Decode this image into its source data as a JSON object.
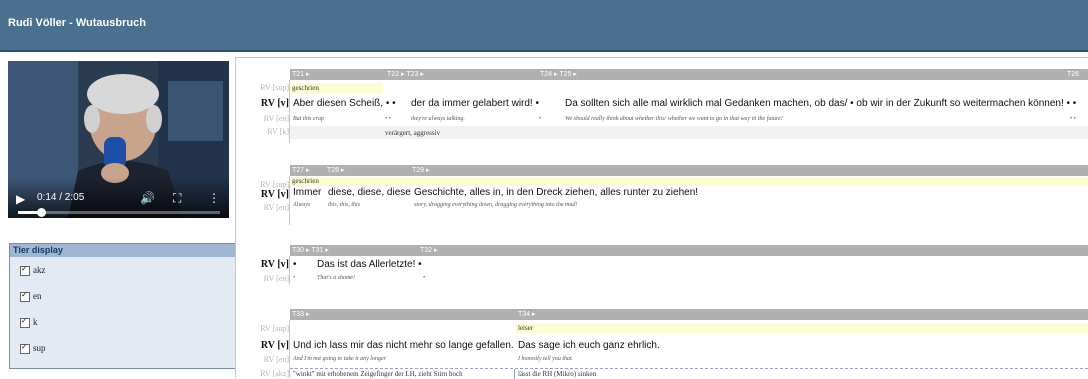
{
  "header": {
    "title": "Rudi Völler - Wutausbruch"
  },
  "colors": {
    "header_bg": "#4a6f8f",
    "sup_bg": "#fdfdd2",
    "timeline_bg": "#b0b0b0"
  },
  "video": {
    "time": "0:14 / 2:05",
    "progress": 0.112,
    "icons": [
      "play-icon",
      "volume-icon",
      "fullscreen-icon",
      "more-icon"
    ]
  },
  "tier_display": {
    "title": "Tier display",
    "items": [
      {
        "label": "akz",
        "checked": true
      },
      {
        "label": "en",
        "checked": true
      },
      {
        "label": "k",
        "checked": true
      },
      {
        "label": "sup",
        "checked": true
      }
    ]
  },
  "labels": {
    "sup": "RV [sup]",
    "v": "RV [v]",
    "en": "RV [en]",
    "k": "RV [k]"
  },
  "blocks": [
    {
      "timeline": [
        "T21 ▸",
        "T22 ▸  T23 ▸",
        "T24 ▸  T25 ▸",
        "T26"
      ],
      "sup": "geschrien",
      "v": [
        "Aber diesen Scheiß, • •",
        "der da immer gelabert wird! •",
        "Da sollten sich alle mal wirklich mal Gedanken machen, ob das/ • ob wir in der Zukunft so weitermachen können! • •"
      ],
      "en": [
        "But this crap",
        "• •",
        "they're always talking.",
        "•",
        "We should really think about whether this/ whether we want to go in that way in the future!",
        "• •"
      ],
      "k": "verärgert, aggressiv"
    },
    {
      "timeline": [
        "T27 ▸",
        "T28 ▸",
        "T29 ▸"
      ],
      "sup": "geschrien",
      "v": [
        "Immer",
        "diese, diese, diese",
        "Geschichte, alles in, in den Dreck ziehen, alles runter zu ziehen!"
      ],
      "en": [
        "Always",
        "this, this, this",
        "story, dragging everything down, dragging everything into the mud!"
      ]
    },
    {
      "timeline": [
        "T30 ▸  T31 ▸",
        "T32 ▸"
      ],
      "v": [
        "•",
        "Das ist das Allerletzte! •"
      ],
      "en": [
        "•",
        "That's a shame!",
        "•"
      ]
    },
    {
      "timeline": [
        "T33 ▸",
        "T34 ▸"
      ],
      "sup": [
        "",
        "leiser"
      ],
      "v": [
        "Und ich lass mir das nicht mehr so lange gefallen.",
        "Das sage ich euch ganz ehrlich."
      ],
      "en": [
        "And I'm not going to take it any longer",
        "I honestly tell you that."
      ],
      "akz": [
        "\"winkt\" mit erhobenem Zeigefinger der LH, zieht Stirn hoch",
        "lässt die RH (Mikro) sinken"
      ],
      "akz_label": "RV [akz]"
    }
  ]
}
